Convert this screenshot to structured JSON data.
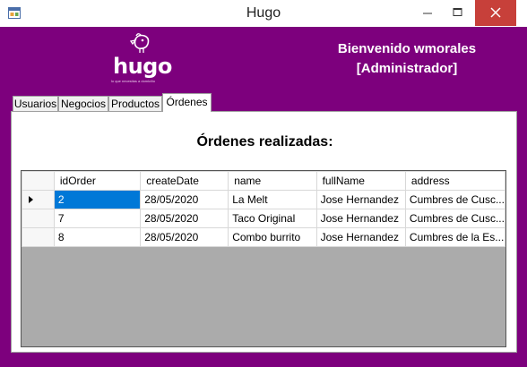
{
  "window": {
    "title": "Hugo",
    "icon": "app-window-icon",
    "controls": [
      "minimize-icon",
      "maximize-icon",
      "close-icon"
    ],
    "accent_color": "#7d007d",
    "close_color": "#c7403a"
  },
  "header": {
    "logo_text": "hugo",
    "logo_tagline": "lo que necesitas a domicilio",
    "welcome_line1": "Bienvenido wmorales",
    "welcome_line2": "[Administrador]"
  },
  "tabs": [
    {
      "label": "Usuarios",
      "active": false
    },
    {
      "label": "Negocios",
      "active": false
    },
    {
      "label": "Productos",
      "active": false
    },
    {
      "label": "Órdenes",
      "active": true
    }
  ],
  "panel": {
    "heading": "Órdenes realizadas:"
  },
  "grid": {
    "columns": [
      "idOrder",
      "createDate",
      "name",
      "fullName",
      "address"
    ],
    "rows": [
      [
        "2",
        "28/05/2020",
        "La Melt",
        "Jose Hernandez",
        "Cumbres de Cusc..."
      ],
      [
        "7",
        "28/05/2020",
        "Taco Original",
        "Jose Hernandez",
        "Cumbres de Cusc..."
      ],
      [
        "8",
        "28/05/2020",
        "Combo burrito",
        "Jose Hernandez",
        "Cumbres de la Es..."
      ]
    ],
    "selected_row": 0,
    "selection_color": "#0078d7"
  }
}
